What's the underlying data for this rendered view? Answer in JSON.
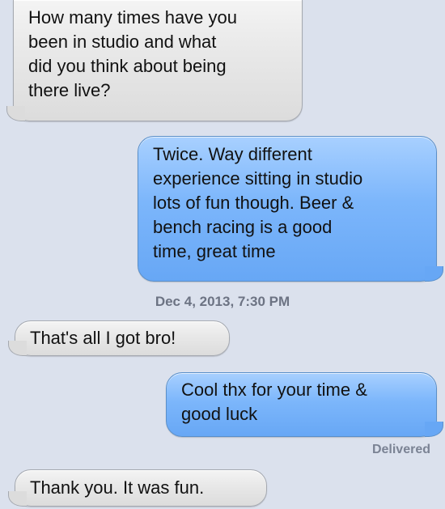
{
  "messages": [
    {
      "id": "msg1",
      "direction": "received",
      "text": "How many times have you\nbeen in studio and what\ndid you think about being\nthere live?"
    },
    {
      "id": "msg2",
      "direction": "sent",
      "text": "Twice. Way different\nexperience sitting in studio\nlots of fun though. Beer &\nbench racing is a good\ntime, great time"
    },
    {
      "id": "msg3",
      "direction": "received",
      "text": "That's all I got bro!"
    },
    {
      "id": "msg4",
      "direction": "sent",
      "text": "Cool thx for your time &\ngood luck"
    },
    {
      "id": "msg5",
      "direction": "received",
      "text": "Thank you. It was fun."
    }
  ],
  "timestamp": "Dec 4, 2013, 7:30 PM",
  "delivery_status": "Delivered",
  "colors": {
    "background": "#dbe1ed",
    "received_bubble": "#e6e6e6",
    "sent_bubble": "#7cb6fb"
  }
}
